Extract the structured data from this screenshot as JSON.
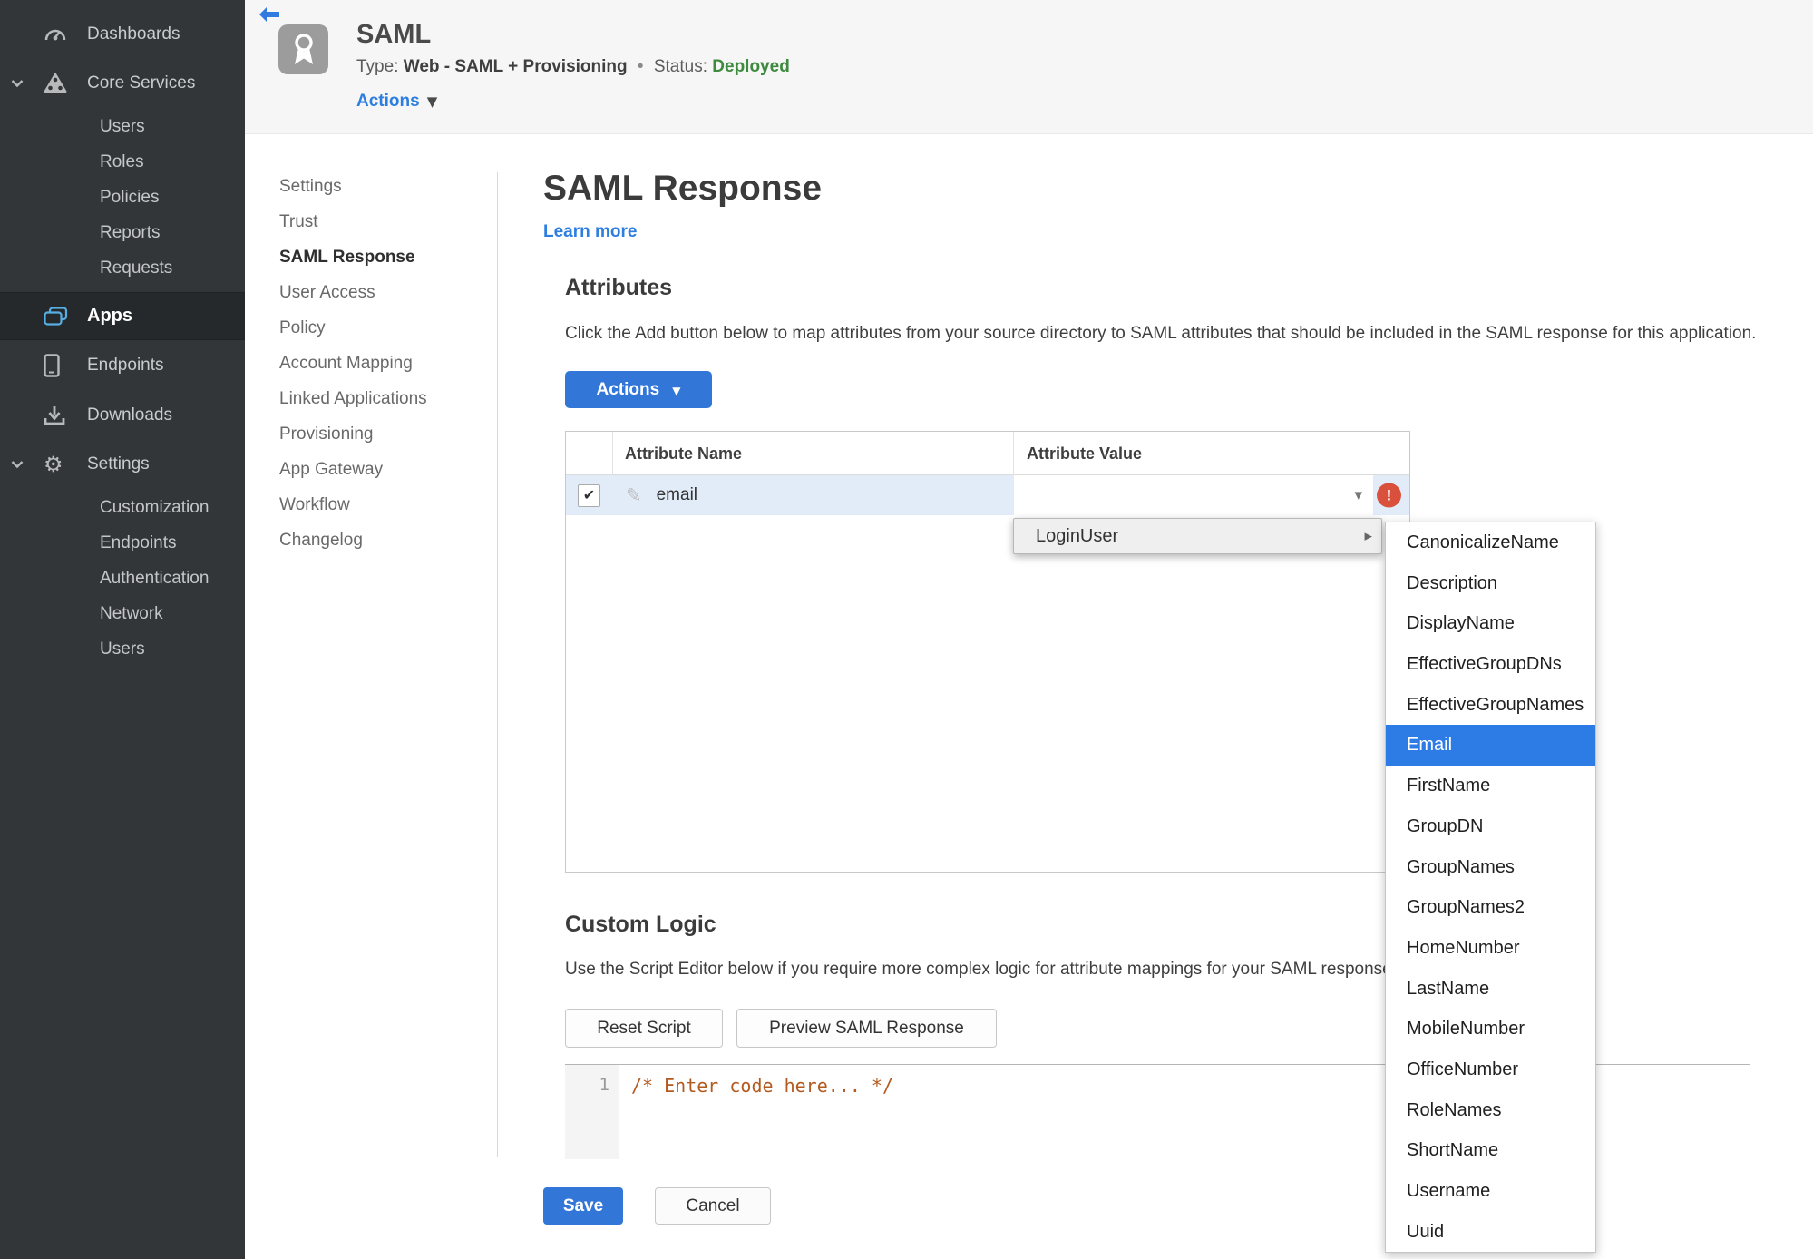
{
  "colors": {
    "accent_blue": "#3277d8",
    "link_blue": "#2e7ee0",
    "status_green": "#3e8a3e",
    "error_red": "#d9513d",
    "selected_blue": "#2d7ce5",
    "sidebar_bg": "#333639"
  },
  "sidebar": {
    "items": [
      {
        "label": "Dashboards",
        "icon": "gauge-icon"
      },
      {
        "label": "Core Services",
        "icon": "core-services-icon"
      },
      {
        "label": "Apps",
        "icon": "apps-icon",
        "active": true
      },
      {
        "label": "Endpoints",
        "icon": "device-icon"
      },
      {
        "label": "Downloads",
        "icon": "download-icon"
      },
      {
        "label": "Settings",
        "icon": "gear-icon"
      }
    ],
    "core_children": [
      "Users",
      "Roles",
      "Policies",
      "Reports",
      "Requests"
    ],
    "settings_children": [
      "Customization",
      "Endpoints",
      "Authentication",
      "Network",
      "Users"
    ]
  },
  "header": {
    "app_title": "SAML",
    "type_label": "Type:",
    "type_value": "Web - SAML + Provisioning",
    "separator": "•",
    "status_label": "Status:",
    "status_value": "Deployed",
    "actions_label": "Actions"
  },
  "subnav": {
    "items": [
      {
        "label": "Settings"
      },
      {
        "label": "Trust"
      },
      {
        "label": "SAML Response",
        "active": true
      },
      {
        "label": "User Access"
      },
      {
        "label": "Policy"
      },
      {
        "label": "Account Mapping"
      },
      {
        "label": "Linked Applications"
      },
      {
        "label": "Provisioning"
      },
      {
        "label": "App Gateway"
      },
      {
        "label": "Workflow"
      },
      {
        "label": "Changelog"
      }
    ]
  },
  "main": {
    "title": "SAML Response",
    "learn_more": "Learn more",
    "attributes": {
      "heading": "Attributes",
      "description": "Click the Add button below to map attributes from your source directory to SAML attributes that should be included in the SAML response for this application.",
      "actions_button": "Actions",
      "table": {
        "columns": [
          "Attribute Name",
          "Attribute Value"
        ],
        "rows": [
          {
            "name": "email",
            "value": "",
            "checked": true,
            "error": true
          }
        ]
      }
    },
    "dropdown": {
      "menu_item": "LoginUser",
      "submenu_items": [
        {
          "label": "CanonicalizeName"
        },
        {
          "label": "Description"
        },
        {
          "label": "DisplayName"
        },
        {
          "label": "EffectiveGroupDNs"
        },
        {
          "label": "EffectiveGroupNames"
        },
        {
          "label": "Email",
          "selected": true
        },
        {
          "label": "FirstName"
        },
        {
          "label": "GroupDN"
        },
        {
          "label": "GroupNames"
        },
        {
          "label": "GroupNames2"
        },
        {
          "label": "HomeNumber"
        },
        {
          "label": "LastName"
        },
        {
          "label": "MobileNumber"
        },
        {
          "label": "OfficeNumber"
        },
        {
          "label": "RoleNames"
        },
        {
          "label": "ShortName"
        },
        {
          "label": "Username"
        },
        {
          "label": "Uuid"
        }
      ]
    },
    "custom_logic": {
      "heading": "Custom Logic",
      "description": "Use the Script Editor below if you require more complex logic for attribute mappings for your SAML response.",
      "reset_button": "Reset Script",
      "preview_button": "Preview SAML Response",
      "editor": {
        "line_number": "1",
        "code": "/* Enter code here... */"
      }
    },
    "footer": {
      "save_label": "Save",
      "cancel_label": "Cancel"
    }
  }
}
